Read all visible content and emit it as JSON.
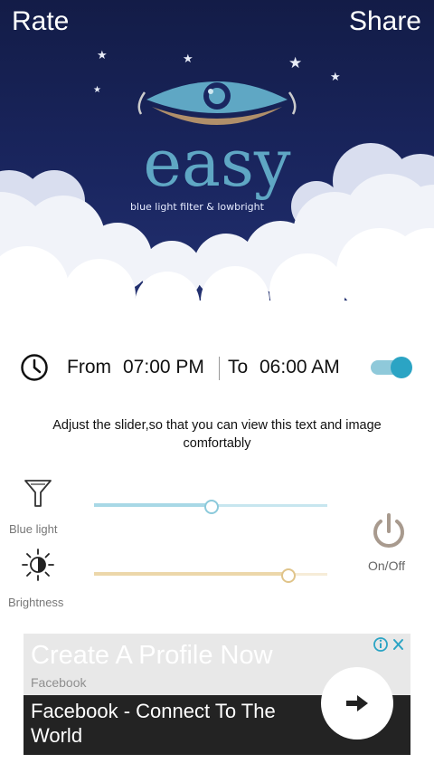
{
  "header": {
    "rate_label": "Rate",
    "share_label": "Share",
    "logo_text": "easy",
    "tagline": "blue light filter & lowbright"
  },
  "schedule": {
    "from_label": "From",
    "from_time": "07:00 PM",
    "to_label": "To",
    "to_time": "06:00 AM",
    "enabled": true
  },
  "instructions": "Adjust the slider,so that you can view this text and image comfortably",
  "controls": {
    "blue_light": {
      "label": "Blue light",
      "value_percent": 50
    },
    "brightness": {
      "label": "Brightness",
      "value_percent": 83
    },
    "power_label": "On/Off"
  },
  "ad": {
    "headline": "Create A Profile Now",
    "advertiser": "Facebook",
    "body": "Facebook - Connect To The World"
  },
  "colors": {
    "sky": "#1a2660",
    "accent": "#2ba4c4",
    "logo_blue": "#5fa7c4",
    "logo_tan": "#b08f6a"
  },
  "icons": {
    "clock": "clock-icon",
    "filter": "funnel-icon",
    "brightness": "sun-icon",
    "power": "power-icon",
    "ad_choices": "info-icon",
    "ad_close": "close-icon",
    "cta": "arrow-right-icon"
  }
}
